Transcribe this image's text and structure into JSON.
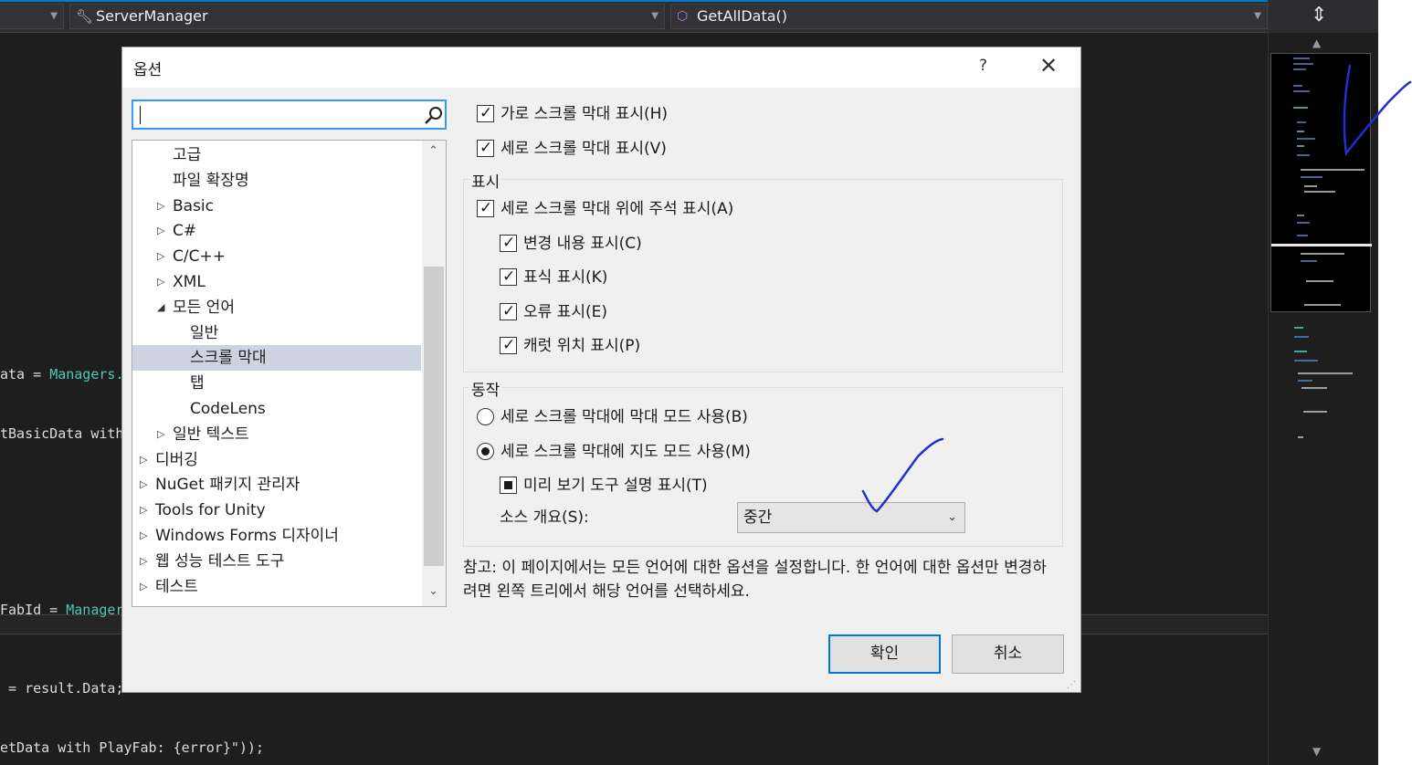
{
  "ide": {
    "combo_left": "",
    "project_combo": "ServerManager",
    "member_combo": "GetAllData()",
    "code_lines": [
      {
        "prefix": "ata = ",
        "type": "Managers.",
        "suffix": ""
      },
      {
        "prefix": "tBasicData with",
        "type": "",
        "suffix": ""
      },
      {
        "prefix": "FabId = ",
        "type": "Manager",
        "suffix": ""
      },
      {
        "prefix": " = result.Data;",
        "type": "",
        "suffix": ""
      },
      {
        "prefix": "etData with PlayFab: {error}\"));",
        "type": "",
        "suffix": ""
      }
    ]
  },
  "dialog": {
    "title": "옵션",
    "help": "?",
    "close": "✕",
    "search_value": "",
    "tree": [
      {
        "label": "고급",
        "indent": 1,
        "expander": ""
      },
      {
        "label": "파일 확장명",
        "indent": 1,
        "expander": ""
      },
      {
        "label": "Basic",
        "indent": 1,
        "expander": "▷"
      },
      {
        "label": "C#",
        "indent": 1,
        "expander": "▷"
      },
      {
        "label": "C/C++",
        "indent": 1,
        "expander": "▷"
      },
      {
        "label": "XML",
        "indent": 1,
        "expander": "▷"
      },
      {
        "label": "모든 언어",
        "indent": 1,
        "expander": "◢"
      },
      {
        "label": "일반",
        "indent": 2,
        "expander": ""
      },
      {
        "label": "스크롤 막대",
        "indent": 2,
        "expander": "",
        "selected": true
      },
      {
        "label": "탭",
        "indent": 2,
        "expander": ""
      },
      {
        "label": "CodeLens",
        "indent": 2,
        "expander": ""
      },
      {
        "label": "일반 텍스트",
        "indent": 1,
        "expander": "▷"
      },
      {
        "label": "디버깅",
        "indent": 0,
        "expander": "▷"
      },
      {
        "label": "NuGet 패키지 관리자",
        "indent": 0,
        "expander": "▷"
      },
      {
        "label": "Tools for Unity",
        "indent": 0,
        "expander": "▷"
      },
      {
        "label": "Windows Forms 디자이너",
        "indent": 0,
        "expander": "▷"
      },
      {
        "label": "웹 성능 테스트 도구",
        "indent": 0,
        "expander": "▷"
      },
      {
        "label": "테스트",
        "indent": 0,
        "expander": "▷"
      }
    ],
    "options": {
      "horizontal": "가로 스크롤 막대 표시(H)",
      "vertical": "세로 스크롤 막대 표시(V)",
      "display_group": "표시",
      "annotations": "세로 스크롤 막대 위에 주석 표시(A)",
      "changes": "변경 내용 표시(C)",
      "marks": "표식 표시(K)",
      "errors": "오류 표시(E)",
      "caret": "캐럿 위치 표시(P)",
      "behavior_group": "동작",
      "bar_mode": "세로 스크롤 막대에 막대 모드 사용(B)",
      "map_mode": "세로 스크롤 막대에 지도 모드 사용(M)",
      "preview": "미리 보기 도구 설명 표시(T)",
      "source_overview_label": "소스 개요(S):",
      "source_overview_value": "중간"
    },
    "checked": {
      "horizontal": true,
      "vertical": true,
      "annotations": true,
      "changes": true,
      "marks": true,
      "errors": true,
      "caret": true,
      "bar_mode": false,
      "map_mode": true,
      "preview": "indeterminate"
    },
    "note": "참고: 이 페이지에서는 모든 언어에 대한 옵션을 설정합니다. 한 언어에 대한 옵션만 변경하려면 왼쪽 트리에서 해당 언어를 선택하세요.",
    "ok": "확인",
    "cancel": "취소"
  },
  "colors": {
    "accent": "#007acc",
    "selection": "#cdd3e0",
    "code_type": "#4ec9b0",
    "ink": "#1f2fd0"
  }
}
